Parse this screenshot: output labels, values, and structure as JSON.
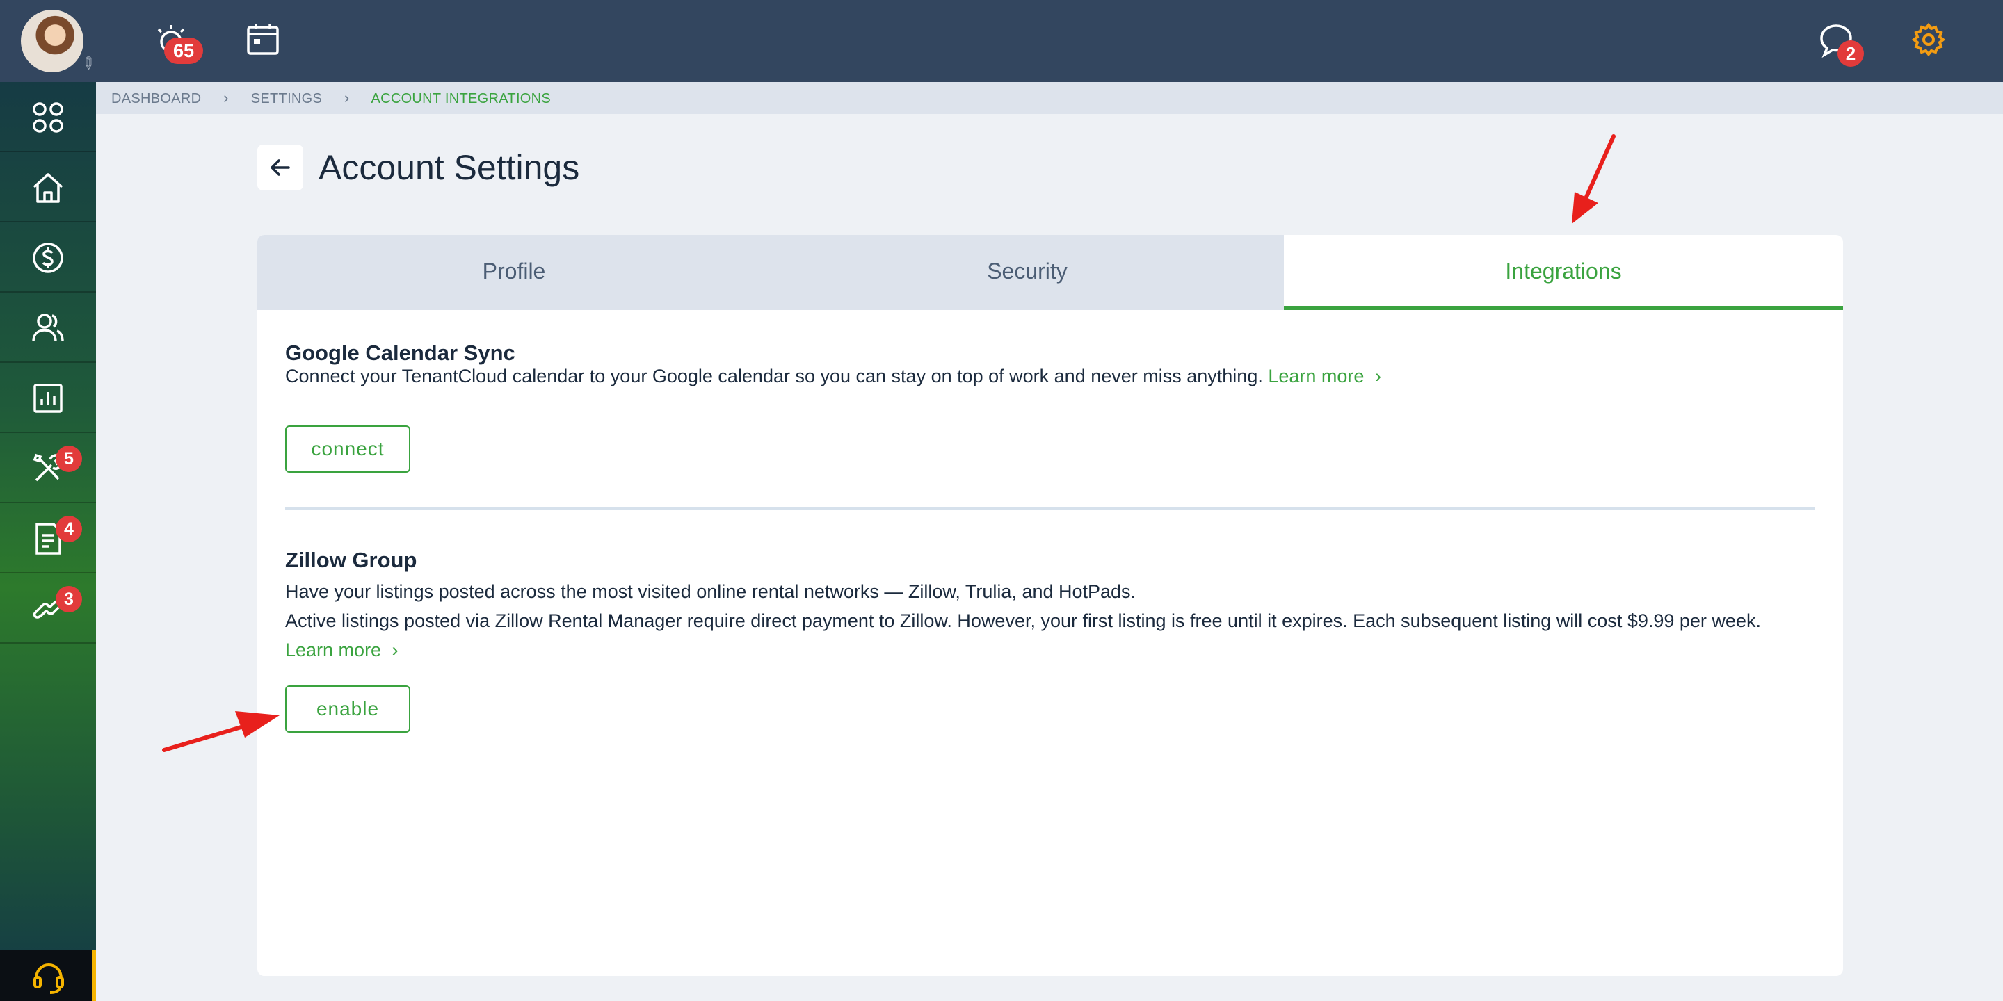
{
  "topbar": {
    "alerts_count": "65",
    "messages_count": "2"
  },
  "sidebar": {
    "items": [
      {
        "icon": "apps-grid-icon",
        "badge": ""
      },
      {
        "icon": "home-icon",
        "badge": ""
      },
      {
        "icon": "dollar-icon",
        "badge": ""
      },
      {
        "icon": "users-icon",
        "badge": ""
      },
      {
        "icon": "reports-chart-icon",
        "badge": ""
      },
      {
        "icon": "tools-icon",
        "badge": "5"
      },
      {
        "icon": "document-icon",
        "badge": "4"
      },
      {
        "icon": "link-icon",
        "badge": "3"
      }
    ]
  },
  "breadcrumb": {
    "items": [
      "DASHBOARD",
      "SETTINGS"
    ],
    "current": "ACCOUNT INTEGRATIONS"
  },
  "page": {
    "title": "Account Settings"
  },
  "tabs": [
    {
      "label": "Profile"
    },
    {
      "label": "Security"
    },
    {
      "label": "Integrations"
    }
  ],
  "google": {
    "title": "Google Calendar Sync",
    "description": "Connect your TenantCloud calendar to your Google calendar so you can stay on top of work and never miss anything.",
    "learn_more": "Learn more",
    "button": "connect"
  },
  "zillow": {
    "title": "Zillow Group",
    "line1": "Have your listings posted across the most visited online rental networks — Zillow, Trulia, and HotPads.",
    "line2": "Active listings posted via Zillow Rental Manager require direct payment to Zillow. However, your first listing is free until it expires. Each subsequent listing will cost $9.99 per week.",
    "learn_more": "Learn more",
    "button": "enable"
  },
  "colors": {
    "accent": "#3aa33f",
    "topbar": "#33465f",
    "badge": "#e23b3b",
    "annotation": "#e8201c"
  }
}
